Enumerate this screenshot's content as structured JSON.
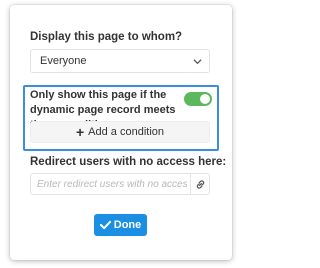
{
  "colors": {
    "accent": "#1a8fe3",
    "highlight_border": "#3b8de0",
    "toggle_on": "#5cb85c"
  },
  "display_section": {
    "label": "Display this page to whom?",
    "selected": "Everyone",
    "dropdown_icon": "chevron-down-icon"
  },
  "condition_section": {
    "text": "Only show this page if the dynamic page record meets these conditions",
    "toggle_on": true,
    "add_button_icon": "plus-icon",
    "add_button_label": "Add a condition"
  },
  "redirect_section": {
    "label": "Redirect users with no access here:",
    "placeholder": "Enter redirect users with no access he",
    "value": "",
    "link_icon": "link-icon"
  },
  "done_button": {
    "icon": "check-icon",
    "label": "Done"
  }
}
